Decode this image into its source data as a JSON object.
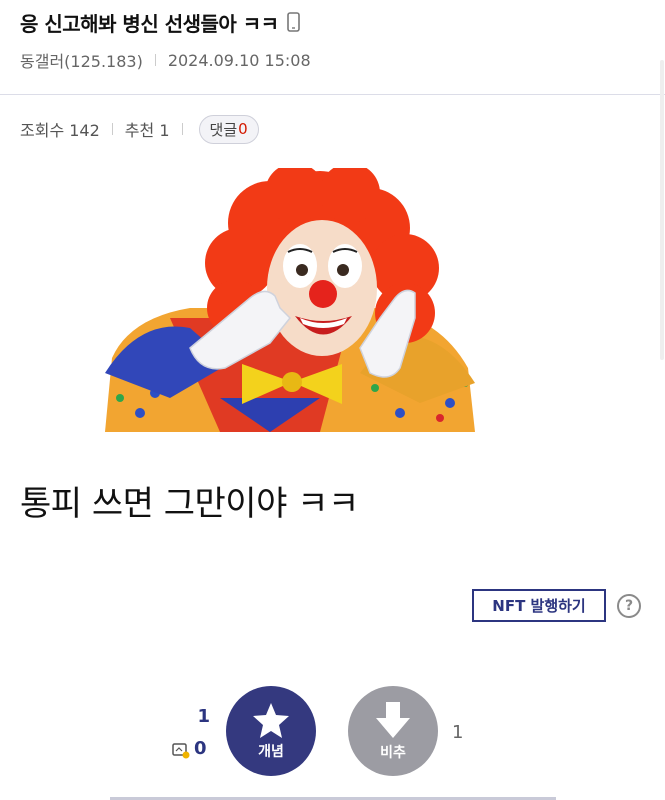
{
  "post": {
    "title": "응 신고해봐 병신 선생들아 ㅋㅋ",
    "author": "동갤러(125.183)",
    "date": "2024.09.10 15:08",
    "views": "조회수 142",
    "recommend": "추천 1",
    "comment_label": "댓글",
    "comment_count": "0",
    "body_text": "통피 쓰면 그만이야 ㅋㅋ"
  },
  "actions": {
    "nft_label": "NFT 발행하기",
    "help_symbol": "?",
    "upvote_label": "개념",
    "downvote_label": "비추",
    "upvote_count": "1",
    "fixed_count": "0",
    "downvote_count": "1"
  },
  "colors": {
    "accent": "#2c3580",
    "comment_count": "#d31900",
    "downvote_bg": "#9c9ca3"
  }
}
